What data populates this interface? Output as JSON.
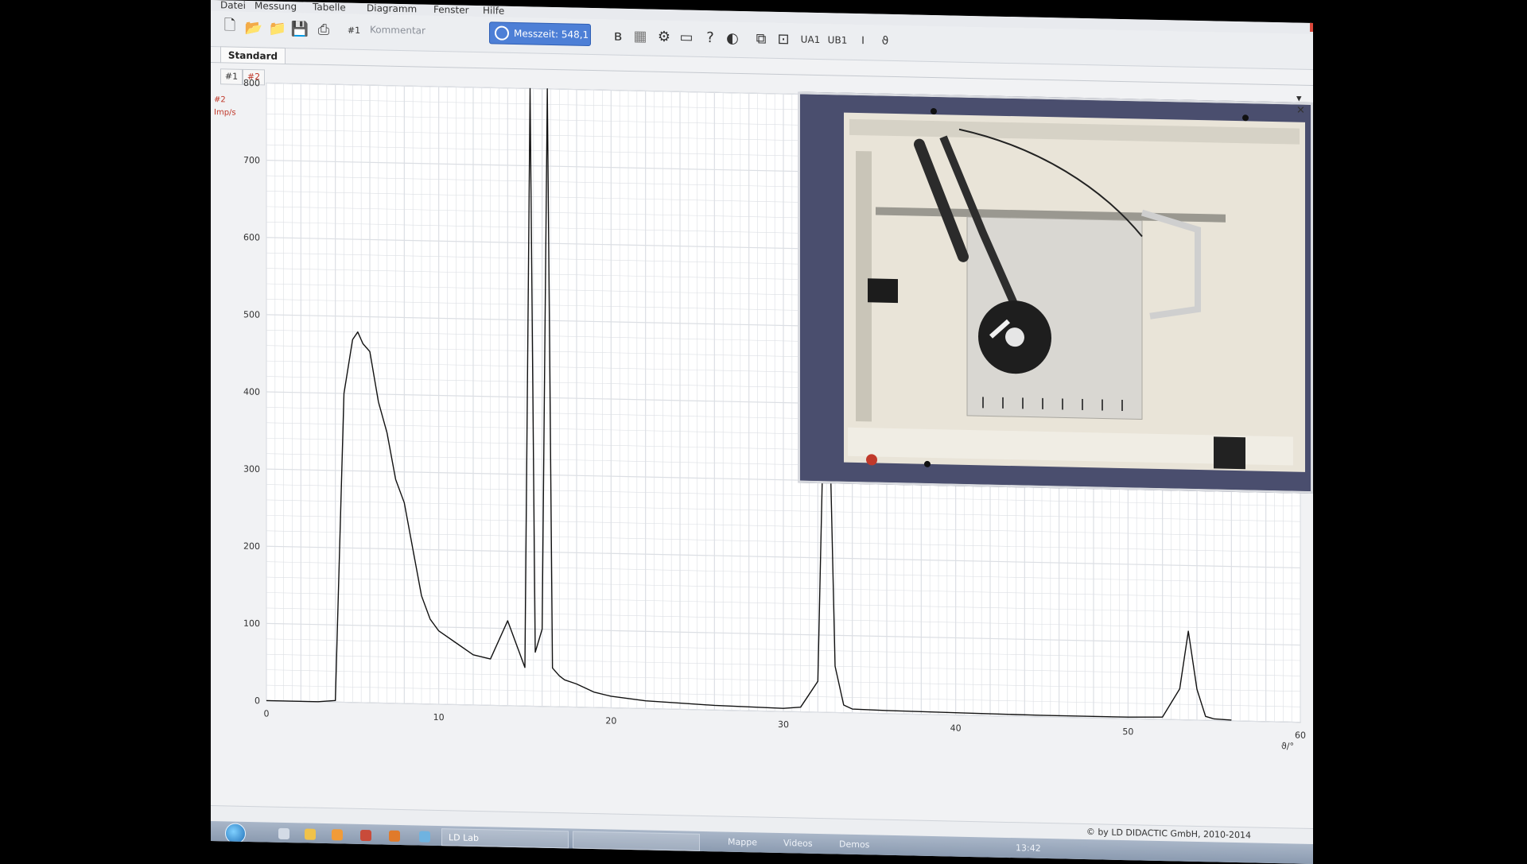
{
  "menu": [
    "Datei",
    "Messung",
    "Tabelle",
    "Diagramm",
    "Fenster",
    "Hilfe"
  ],
  "toolbar": {
    "measurement_number": "#1",
    "comment_placeholder": "Kommentar",
    "measure_time": "Messzeit: 548,1",
    "ua_label": "UA1",
    "ub_label": "UB1"
  },
  "tabs": {
    "main": "Standard",
    "sub": [
      "#1",
      "#2"
    ]
  },
  "sidebar": {
    "series": "#2",
    "unit": "Imp/s"
  },
  "status": {
    "copyright": "© by LD DIDACTIC GmbH, 2010-2014"
  },
  "taskbar": {
    "app_item": "LD Lab",
    "toolbars": [
      "Mappe",
      "Videos",
      "Demos"
    ],
    "clock": "13:42"
  },
  "colors": {
    "accent": "#4d7fd6",
    "trace": "#111111",
    "grid": "#bfc4cc",
    "series_label": "#c0392b"
  },
  "chart_data": {
    "type": "line",
    "xlim": [
      0,
      60
    ],
    "ylim": [
      0,
      800
    ],
    "x_ticks": [
      0,
      10,
      20,
      30,
      40,
      50,
      60
    ],
    "y_ticks": [
      0,
      100,
      200,
      300,
      400,
      500,
      600,
      700,
      800
    ],
    "xlabel": "ϑ/°",
    "ylabel": "Imp/s",
    "grid": true,
    "series": [
      {
        "x": [
          0,
          3,
          4,
          4.5,
          5,
          5.3,
          5.6,
          6,
          6.5,
          7,
          7.5,
          8,
          8.5,
          9,
          9.5,
          10,
          11,
          12,
          13,
          14,
          14.5,
          15,
          15.3,
          15.6,
          16,
          16.3,
          16.6,
          17,
          17.3,
          18,
          19,
          20,
          22,
          24,
          26,
          28,
          30,
          31,
          32,
          32.5,
          33,
          33.5,
          34,
          36,
          40,
          45,
          50,
          52,
          53,
          53.5,
          54,
          54.5,
          55,
          56
        ],
        "y": [
          0,
          0,
          2,
          400,
          470,
          480,
          465,
          455,
          390,
          350,
          290,
          260,
          200,
          140,
          110,
          95,
          80,
          65,
          60,
          110,
          80,
          50,
          900,
          70,
          100,
          900,
          50,
          40,
          35,
          30,
          20,
          15,
          10,
          8,
          6,
          5,
          4,
          6,
          40,
          550,
          60,
          10,
          5,
          4,
          3,
          2,
          2,
          3,
          40,
          115,
          40,
          5,
          2,
          1
        ]
      }
    ]
  }
}
